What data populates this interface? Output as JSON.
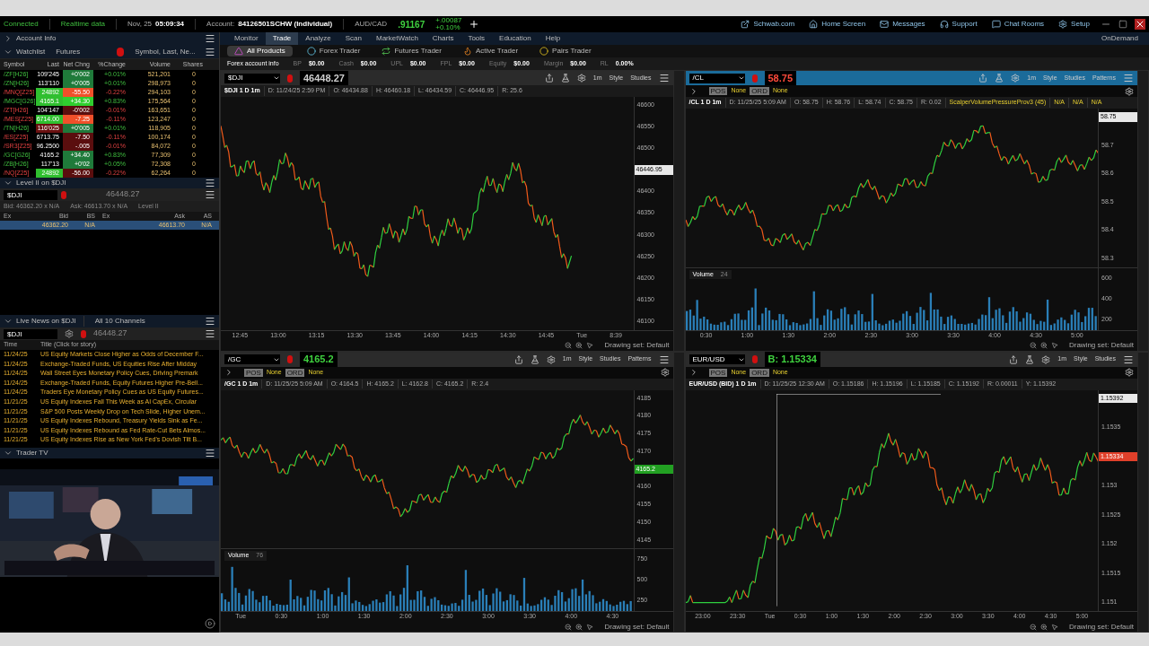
{
  "status_bar": {
    "connection": "Connected",
    "feed": "Realtime data",
    "date": "Nov, 25",
    "time": "05:09:34",
    "account_label": "Account:",
    "account": "84126501SCHW (Individual)",
    "pair": "AUD/CAD",
    "rate": ".91167",
    "change": "+.00087",
    "change_pct": "+0.10%"
  },
  "top_links": [
    {
      "label": "Schwab.com",
      "kind": "external"
    },
    {
      "label": "Home Screen",
      "kind": "home"
    },
    {
      "label": "Messages",
      "kind": "mail"
    },
    {
      "label": "Support",
      "kind": "support"
    },
    {
      "label": "Chat Rooms",
      "kind": "chat"
    },
    {
      "label": "Setup",
      "kind": "settings"
    }
  ],
  "on_demand": "OnDemand",
  "menu": [
    {
      "label": "Monitor",
      "selected": false
    },
    {
      "label": "Trade",
      "selected": true
    },
    {
      "label": "Analyze",
      "selected": false
    },
    {
      "label": "Scan",
      "selected": false
    },
    {
      "label": "MarketWatch",
      "selected": false
    },
    {
      "label": "Charts",
      "selected": false
    },
    {
      "label": "Tools",
      "selected": false
    },
    {
      "label": "Education",
      "selected": false
    },
    {
      "label": "Help",
      "selected": false
    }
  ],
  "subtabs": [
    {
      "label": "All Products",
      "selected": true,
      "kind": "all"
    },
    {
      "label": "Forex Trader",
      "selected": false,
      "kind": "forex"
    },
    {
      "label": "Futures Trader",
      "selected": false,
      "kind": "futures"
    },
    {
      "label": "Active Trader",
      "selected": false,
      "kind": "active"
    },
    {
      "label": "Pairs Trader",
      "selected": false,
      "kind": "pairs"
    }
  ],
  "account_info": {
    "title": "Forex account info",
    "items": [
      {
        "label": "BP",
        "value": "$0.00"
      },
      {
        "label": "Cash",
        "value": "$0.00"
      },
      {
        "label": "UPL",
        "value": "$0.00"
      },
      {
        "label": "FPL",
        "value": "$0.00"
      },
      {
        "label": "Equity",
        "value": "$0.00"
      },
      {
        "label": "Margin",
        "value": "$0.00"
      },
      {
        "label": "RL",
        "value": "0.00%"
      }
    ]
  },
  "sidebar": {
    "account_header": "Account Info",
    "watchlist": {
      "title": "Watchlist",
      "list": "Futures",
      "columns_label": "Symbol, Last, Ne...",
      "columns": [
        "Symbol",
        "Last",
        "Net Chng",
        "%Change",
        "Volume",
        "Shares"
      ],
      "rows": [
        {
          "symbol": "/ZF[H26]",
          "last": "109'245",
          "last_uptick": false,
          "last_downtick": false,
          "net_chng": "+0'002",
          "flash": false,
          "pct_change": "+0.01%",
          "volume": "521,201",
          "shares": "0",
          "rising": true
        },
        {
          "symbol": "/ZN[H26]",
          "last": "113'110",
          "last_uptick": false,
          "last_downtick": false,
          "net_chng": "+0'005",
          "flash": false,
          "pct_change": "+0.01%",
          "volume": "298,973",
          "shares": "0",
          "rising": true
        },
        {
          "symbol": "/MNQ[Z25]",
          "last": "24892",
          "last_uptick": true,
          "last_downtick": false,
          "net_chng": "-55.50",
          "flash": true,
          "pct_change": "-0.22%",
          "volume": "294,103",
          "shares": "0",
          "rising": false
        },
        {
          "symbol": "/MGC[G26]",
          "last": "4165.1",
          "last_uptick": true,
          "last_downtick": false,
          "net_chng": "+34.30",
          "flash": true,
          "pct_change": "+0.83%",
          "volume": "175,564",
          "shares": "0",
          "rising": true
        },
        {
          "symbol": "/ZT[H26]",
          "last": "104'147",
          "last_uptick": false,
          "last_downtick": false,
          "net_chng": "-0'002",
          "flash": false,
          "pct_change": "-0.01%",
          "volume": "163,651",
          "shares": "0",
          "rising": false
        },
        {
          "symbol": "/MES[Z25]",
          "last": "6714.00",
          "last_uptick": true,
          "last_downtick": false,
          "net_chng": "-7.25",
          "flash": true,
          "pct_change": "-0.11%",
          "volume": "123,247",
          "shares": "0",
          "rising": false
        },
        {
          "symbol": "/TN[H26]",
          "last": "116'025",
          "last_uptick": false,
          "last_downtick": true,
          "net_chng": "+0'005",
          "flash": false,
          "pct_change": "+0.01%",
          "volume": "118,905",
          "shares": "0",
          "rising": true
        },
        {
          "symbol": "/ES[Z25]",
          "last": "6713.75",
          "last_uptick": false,
          "last_downtick": false,
          "net_chng": "-7.50",
          "flash": false,
          "pct_change": "-0.11%",
          "volume": "100,174",
          "shares": "0",
          "rising": false
        },
        {
          "symbol": "/SR3[Z25]",
          "last": "96.2500",
          "last_uptick": false,
          "last_downtick": false,
          "net_chng": "-.005",
          "flash": false,
          "pct_change": "-0.01%",
          "volume": "84,072",
          "shares": "0",
          "rising": false
        },
        {
          "symbol": "/GC[G26]",
          "last": "4165.2",
          "last_uptick": false,
          "last_downtick": false,
          "net_chng": "+34.40",
          "flash": false,
          "pct_change": "+0.83%",
          "volume": "77,309",
          "shares": "0",
          "rising": true
        },
        {
          "symbol": "/ZB[H26]",
          "last": "117'13",
          "last_uptick": false,
          "last_downtick": false,
          "net_chng": "+0'02",
          "flash": false,
          "pct_change": "+0.05%",
          "volume": "72,308",
          "shares": "0",
          "rising": true
        },
        {
          "symbol": "/NQ[Z25]",
          "last": "24892",
          "last_uptick": true,
          "last_downtick": false,
          "net_chng": "-56.00",
          "flash": false,
          "pct_change": "-0.22%",
          "volume": "62,264",
          "shares": "0",
          "rising": false
        }
      ]
    },
    "level2": {
      "title": "Level II on $DJI",
      "symbol": "$DJI",
      "price": "46448.27",
      "bid": "Bid: 46362.20 x N/A",
      "ask": "Ask: 46613.70 x N/A",
      "label": "Level II",
      "columns": [
        "Ex",
        "Bid",
        "BS",
        "Ex",
        "Ask",
        "AS"
      ],
      "row": {
        "bid": "46362.20",
        "bs": "N/A",
        "ask": "46613.70",
        "as": "N/A"
      }
    },
    "news": {
      "title": "Live News on $DJI",
      "channels": "All 10 Channels",
      "symbol": "$DJI",
      "price": "46448.27",
      "columns": [
        "Time",
        "Title (Click for story)"
      ],
      "rows": [
        {
          "time": "11/24/25",
          "title": "US Equity Markets Close Higher as Odds of December F..."
        },
        {
          "time": "11/24/25",
          "title": "Exchange-Traded Funds, US Equities Rise After Midday"
        },
        {
          "time": "11/24/25",
          "title": "Wall Street Eyes Monetary Policy Cues, Driving Premark"
        },
        {
          "time": "11/24/25",
          "title": "Exchange-Traded Funds, Equity Futures Higher Pre-Bell..."
        },
        {
          "time": "11/24/25",
          "title": "Traders Eye Monetary Policy Cues as US Equity Futures..."
        },
        {
          "time": "11/21/25",
          "title": "US Equity Indexes Fall This Week as AI CapEx, Circular"
        },
        {
          "time": "11/21/25",
          "title": "S&P 500 Posts Weekly Drop on Tech Slide, Higher Unem..."
        },
        {
          "time": "11/21/25",
          "title": "US Equity Indexes Rebound, Treasury Yields Sink as Fe..."
        },
        {
          "time": "11/21/25",
          "title": "US Equity Indexes Rebound as Fed Rate-Cut Bets Almos..."
        },
        {
          "time": "11/21/25",
          "title": "US Equity Indexes Rise as New York Fed's Dovish Tilt B..."
        }
      ]
    },
    "trader_tv": {
      "title": "Trader TV"
    }
  },
  "charts": [
    {
      "symbol": "$DJI",
      "selected": false,
      "price": "46448.27",
      "color": "#cfcfcf",
      "title": "$DJI 1 D 1m",
      "fields": [
        "D: 11/24/25 2:59 PM",
        "O: 46434.88",
        "H: 46460.18",
        "L: 46434.59",
        "C: 46446.95",
        "R: 25.6"
      ],
      "toolbar": [
        "1m",
        "Style",
        "Studies"
      ],
      "y_labels": [
        {
          "text": "46600",
          "kind": "tick"
        },
        {
          "text": "46550",
          "kind": "tick"
        },
        {
          "text": "46500",
          "kind": "tick"
        },
        {
          "text": "46446.95",
          "kind": "tag",
          "color": "#e8e8e8"
        },
        {
          "text": "46400",
          "kind": "tick"
        },
        {
          "text": "46350",
          "kind": "tick"
        },
        {
          "text": "46300",
          "kind": "tick"
        },
        {
          "text": "46250",
          "kind": "tick"
        },
        {
          "text": "46200",
          "kind": "tick"
        },
        {
          "text": "46150",
          "kind": "tick"
        },
        {
          "text": "46100",
          "kind": "tick"
        }
      ],
      "x_labels": [
        "12:45",
        "13:00",
        "13:15",
        "13:30",
        "13:45",
        "14:00",
        "14:15",
        "14:30",
        "14:45",
        "Tue",
        "8:39"
      ],
      "drawing_set": "Drawing set: Default"
    },
    {
      "symbol": "/CL",
      "selected": true,
      "price": "58.75",
      "color": "#ff4a3a",
      "orders": {
        "pos_label": "POS",
        "pos": "None",
        "ord_label": "ORD",
        "ord": "None"
      },
      "title": "/CL 1 D 1m",
      "fields": [
        "D: 11/25/25 5:09 AM",
        "O: 58.75",
        "H: 58.76",
        "L: 58.74",
        "C: 58.75",
        "R: 0.02"
      ],
      "study": "ScalperVolumePressureProv3 (45)",
      "study_values": [
        "N/A",
        "N/A",
        "N/A"
      ],
      "toolbar": [
        "1m",
        "Style",
        "Studies",
        "Patterns"
      ],
      "y_labels": [
        {
          "text": "58.75",
          "kind": "tag",
          "color": "#e8e8e8"
        },
        {
          "text": "58.7",
          "kind": "tick"
        },
        {
          "text": "58.6",
          "kind": "tick"
        },
        {
          "text": "58.5",
          "kind": "tick"
        },
        {
          "text": "58.4",
          "kind": "tick"
        },
        {
          "text": "58.3",
          "kind": "tick"
        }
      ],
      "volume": {
        "label": "Volume",
        "value": "24",
        "y_labels": [
          "600",
          "400",
          "200"
        ]
      },
      "x_labels": [
        "0:30",
        "1:00",
        "1:30",
        "2:00",
        "2:30",
        "3:00",
        "3:30",
        "4:00",
        "4:30",
        "5:00"
      ],
      "drawing_set": "Drawing set: Default"
    },
    {
      "symbol": "/GC",
      "selected": false,
      "price": "4165.2",
      "color": "#3fd13f",
      "orders": {
        "pos_label": "POS",
        "pos": "None",
        "ord_label": "ORD",
        "ord": "None"
      },
      "title": "/GC 1 D 1m",
      "fields": [
        "D: 11/25/25 5:09 AM",
        "O: 4164.5",
        "H: 4165.2",
        "L: 4162.8",
        "C: 4165.2",
        "R: 2.4"
      ],
      "toolbar": [
        "1m",
        "Style",
        "Studies",
        "Patterns"
      ],
      "y_labels": [
        {
          "text": "4185",
          "kind": "tick"
        },
        {
          "text": "4180",
          "kind": "tick"
        },
        {
          "text": "4175",
          "kind": "tick"
        },
        {
          "text": "4170",
          "kind": "tick"
        },
        {
          "text": "4165.2",
          "kind": "tag",
          "color": "#22a022"
        },
        {
          "text": "4160",
          "kind": "tick"
        },
        {
          "text": "4155",
          "kind": "tick"
        },
        {
          "text": "4150",
          "kind": "tick"
        },
        {
          "text": "4145",
          "kind": "tick"
        }
      ],
      "volume": {
        "label": "Volume",
        "value": "76",
        "y_labels": [
          "750",
          "500",
          "250"
        ]
      },
      "x_labels": [
        "Tue",
        "0:30",
        "1:00",
        "1:30",
        "2:00",
        "2:30",
        "3:00",
        "3:30",
        "4:00",
        "4:30"
      ],
      "drawing_set": "Drawing set: Default"
    },
    {
      "symbol": "EUR/USD",
      "selected": false,
      "price": "B: 1.15334",
      "color": "#3fd13f",
      "orders": {
        "pos_label": "POS",
        "pos": "None",
        "ord_label": "ORD",
        "ord": "None"
      },
      "title": "EUR/USD (BID) 1 D 1m",
      "fields": [
        "D: 11/25/25 12:30 AM",
        "O: 1.15186",
        "H: 1.15196",
        "L: 1.15185",
        "C: 1.15192",
        "R: 0.00011",
        "Y: 1.15392"
      ],
      "toolbar": [
        "1m",
        "Style",
        "Studies"
      ],
      "y_labels": [
        {
          "text": "1.15392",
          "kind": "tag",
          "color": "#e8e8e8"
        },
        {
          "text": "1.1535",
          "kind": "tick"
        },
        {
          "text": "1.15334",
          "kind": "tag",
          "color": "#e0402a"
        },
        {
          "text": "1.153",
          "kind": "tick"
        },
        {
          "text": "1.1525",
          "kind": "tick"
        },
        {
          "text": "1.152",
          "kind": "tick"
        },
        {
          "text": "1.1515",
          "kind": "tick"
        },
        {
          "text": "1.151",
          "kind": "tick"
        }
      ],
      "crosshair": true,
      "x_labels": [
        "23:00",
        "23:30",
        "Tue",
        "0:30",
        "1:00",
        "1:30",
        "2:00",
        "2:30",
        "3:00",
        "3:30",
        "4:00",
        "4:30",
        "5:00"
      ],
      "drawing_set": "Drawing set: Default"
    }
  ]
}
